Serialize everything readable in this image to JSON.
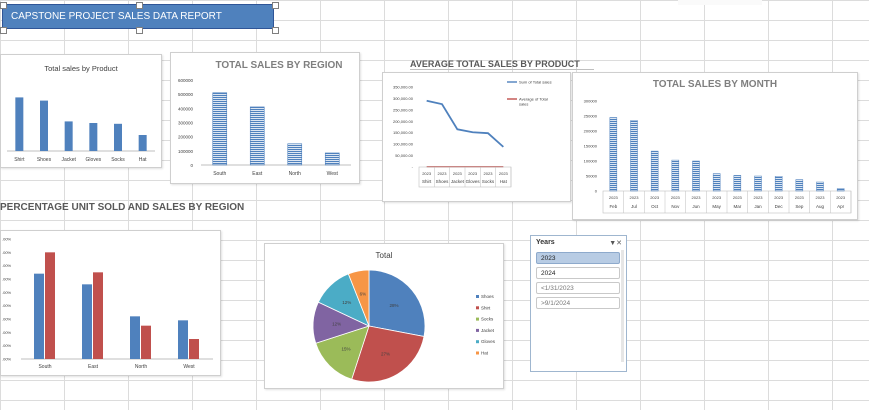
{
  "report_title": "CAPSTONE PROJECT SALES DATA REPORT",
  "section_titles": {
    "avg_sales": "AVERAGE  TOTAL SALES BY PRODUCT",
    "pct_region": "PERCENTAGE UNIT SOLD AND SALES BY REGION"
  },
  "slicer": {
    "header": "Years",
    "items": [
      "2023",
      "2024",
      "<1/31/2023",
      ">9/1/2024"
    ],
    "selected": "2023"
  },
  "colors": {
    "blue": "#4f81bd",
    "red": "#c0504d",
    "green": "#9bbb59",
    "purple": "#8064a2",
    "teal": "#4bacc6",
    "orange": "#f79646",
    "banner": "#4f81bd"
  },
  "chart_data": [
    {
      "id": "product",
      "type": "bar",
      "title": "Total sales by Product",
      "categories": [
        "Shirt",
        "Shoes",
        "Jacket",
        "Gloves",
        "Socks",
        "Hat"
      ],
      "values": [
        335000,
        315000,
        185000,
        175000,
        170000,
        100000
      ],
      "ylim": [
        0,
        450000
      ],
      "grid": false,
      "legend": "none"
    },
    {
      "id": "region",
      "type": "bar",
      "title": "TOTAL SALES BY REGION",
      "categories": [
        "South",
        "East",
        "North",
        "West"
      ],
      "values": [
        510000,
        410000,
        150000,
        85000
      ],
      "ylim": [
        0,
        600000
      ],
      "yticks": [
        "0",
        "100000",
        "200000",
        "300000",
        "400000",
        "500000",
        "600000"
      ],
      "grid": false,
      "legend": "none"
    },
    {
      "id": "avg",
      "type": "line",
      "title": "",
      "categories": [
        "Shirt",
        "Shoes",
        "Jacket",
        "Gloves",
        "Socks",
        "Hat"
      ],
      "category_group": "2023",
      "series": [
        {
          "name": "Sum of Total sales",
          "values": [
            290000,
            275000,
            165000,
            152000,
            148000,
            88000
          ]
        },
        {
          "name": "Average of Total sales",
          "values": [
            1000,
            1000,
            1000,
            1000,
            1000,
            1000
          ]
        }
      ],
      "ylim": [
        0,
        350000
      ],
      "yticks": [
        "-",
        "50,000.00",
        "100,000.00",
        "150,000.00",
        "200,000.00",
        "250,000.00",
        "300,000.00",
        "350,000.00"
      ],
      "legend": "right"
    },
    {
      "id": "month",
      "type": "bar",
      "title": "TOTAL SALES BY MONTH",
      "categories": [
        "Feb",
        "Jul",
        "Oct",
        "Nov",
        "Jun",
        "May",
        "Mar",
        "Jan",
        "Dec",
        "Sep",
        "Aug",
        "Apr"
      ],
      "years": [
        "2023",
        "2023",
        "2023",
        "2023",
        "2023",
        "2023",
        "2023",
        "2023",
        "2023",
        "2023",
        "2023",
        "2023"
      ],
      "values": [
        245000,
        235000,
        133000,
        103000,
        100000,
        58000,
        52000,
        50000,
        49000,
        38000,
        30000,
        8000
      ],
      "ylim": [
        0,
        300000
      ],
      "yticks": [
        "0",
        "50000",
        "100000",
        "150000",
        "200000",
        "250000",
        "300000"
      ],
      "grid": false,
      "legend": "none"
    },
    {
      "id": "pct",
      "type": "bar",
      "title": "PERCENTAGE UNIT SOLD AND SALES BY REGION",
      "categories": [
        "South",
        "East",
        "North",
        "West"
      ],
      "series": [
        {
          "values": [
            32,
            28,
            16,
            14.5
          ]
        },
        {
          "values": [
            40,
            32.5,
            12.5,
            7.5
          ]
        }
      ],
      "ylim": [
        0,
        45
      ],
      "yticks": [
        ".00%",
        ".00%",
        ".00%",
        ".00%",
        ".00%",
        ".00%",
        ".00%",
        ".00%",
        ".00%",
        ".00%"
      ],
      "legend": "none"
    },
    {
      "id": "pie",
      "type": "pie",
      "title": "Total",
      "slices": [
        {
          "label": "Shoes",
          "value": 28,
          "text": "28%"
        },
        {
          "label": "Shirt",
          "value": 27,
          "text": "27%"
        },
        {
          "label": "Socks",
          "value": 15,
          "text": "15%"
        },
        {
          "label": "Jacket",
          "value": 12,
          "text": "12%"
        },
        {
          "label": "Gloves",
          "value": 12,
          "text": "12%"
        },
        {
          "label": "Hat",
          "value": 6,
          "text": "6%"
        }
      ],
      "legend": "right"
    }
  ]
}
